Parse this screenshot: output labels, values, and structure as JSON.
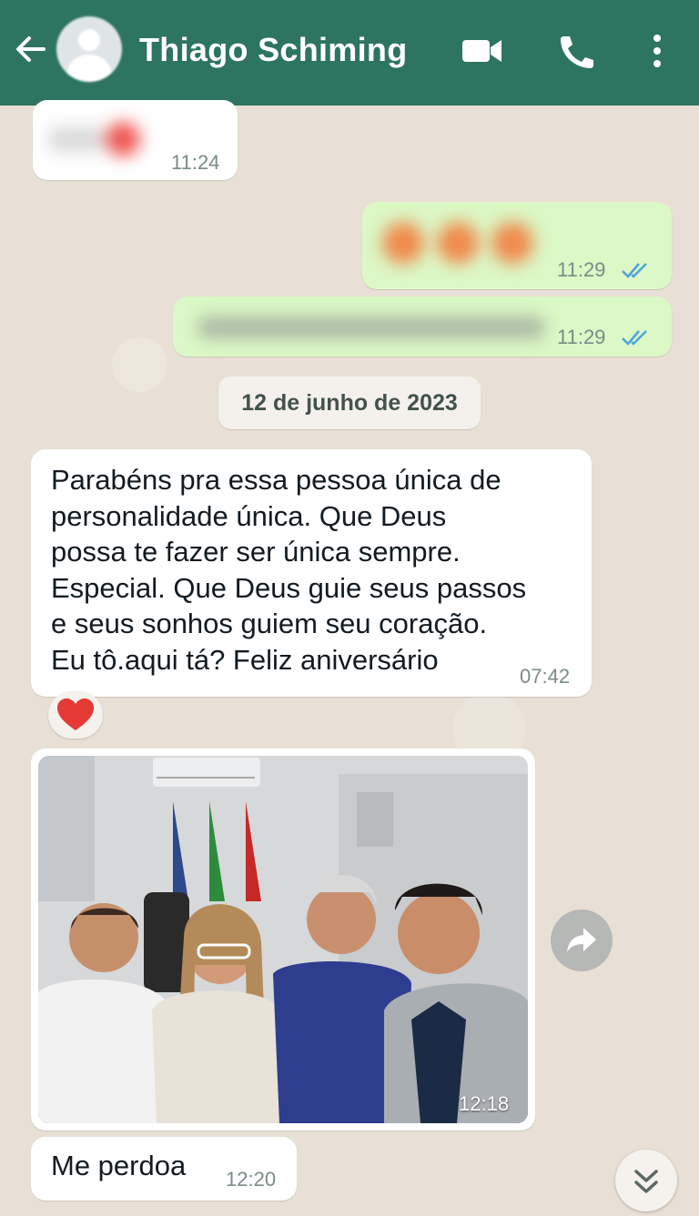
{
  "header": {
    "contact_name": "Thiago Schiming",
    "back_icon": "arrow-left-icon",
    "avatar_icon": "default-avatar-icon",
    "video_icon": "video-call-icon",
    "call_icon": "phone-icon",
    "menu_icon": "more-vert-icon",
    "color": "#2e7561"
  },
  "messages": [
    {
      "direction": "in",
      "text": "",
      "time": "11:24",
      "blurred": true
    },
    {
      "direction": "out",
      "text": "",
      "time": "11:29",
      "blurred": true,
      "status": "read"
    },
    {
      "direction": "out",
      "text": "",
      "time": "11:29",
      "blurred": true,
      "status": "read"
    }
  ],
  "date_separator": "12 de junho de 2023",
  "birthday_message": {
    "text": "Parabéns pra essa pessoa única de\npersonalidade única.  Que Deus\npossa te fazer ser única sempre.\nEspecial. Que Deus guie seus passos\ne seus sonhos guiem seu coração.\nEu tô.aqui tá? Feliz aniversário",
    "time": "07:42",
    "reaction": "❤️"
  },
  "photo_message": {
    "time": "12:18",
    "forward_icon": "forward-icon"
  },
  "last_message": {
    "text": "Me perdoa",
    "time": "12:20"
  },
  "scroll_icon": "chevron-double-down-icon",
  "colors": {
    "incoming": "#ffffff",
    "outgoing": "#dcf8c6",
    "read_ticks": "#4fa3d8"
  }
}
